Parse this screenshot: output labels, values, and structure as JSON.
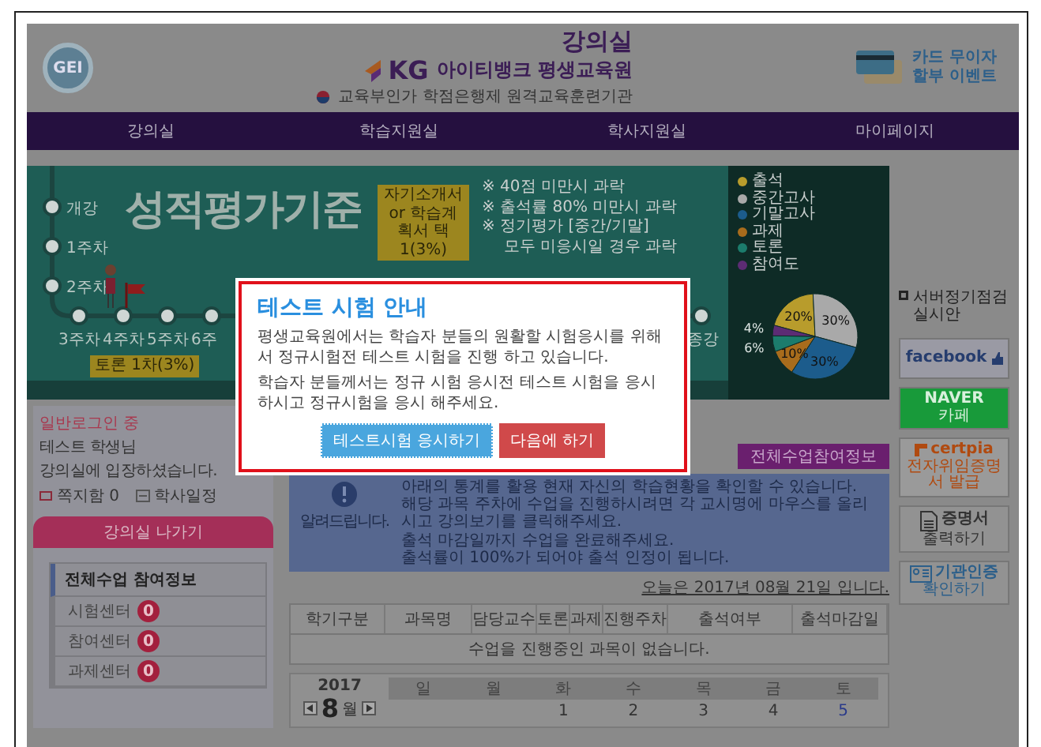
{
  "header": {
    "badge": "GEI",
    "room_title": "강의실",
    "kg": "KG",
    "academy": "아이티뱅크 평생교육원",
    "accreditation": "교육부인가 학점은행제 원격교육훈련기관",
    "event": [
      "카드 무이자",
      "할부 이벤트"
    ]
  },
  "nav": [
    {
      "label": "강의실",
      "selected": false
    },
    {
      "label": "학습지원실",
      "selected": false
    },
    {
      "label": "학사지원실",
      "selected": false
    },
    {
      "label": "마이페이지",
      "selected": false
    }
  ],
  "banner": {
    "title": "성적평가기준",
    "stops": [
      {
        "label": "개강",
        "kind": "vertical"
      },
      {
        "label": "1주차",
        "kind": "vertical"
      },
      {
        "label": "2주차",
        "kind": "vertical"
      },
      {
        "label": "3주차",
        "kind": "horizontal"
      },
      {
        "label": "4주차",
        "kind": "horizontal"
      },
      {
        "label": "5주차",
        "kind": "horizontal"
      },
      {
        "label": "6주",
        "kind": "horizontal"
      },
      {
        "label": "종강",
        "kind": "end"
      }
    ],
    "tags": [
      "토론 1차(3%)",
      "자기소개서 or 학습계획서 택1(3%)"
    ],
    "notes": [
      "※ 40점 미만시 과락",
      "※ 출석률 80% 미만시 과락",
      "※ 정기평가 [중간/기말]",
      "모두 미응시일 경우 과락"
    ],
    "chart_data": {
      "type": "pie",
      "categories": [
        "출석",
        "중간고사",
        "기말고사",
        "과제",
        "토론",
        "참여도"
      ],
      "values": [
        20,
        30,
        30,
        10,
        6,
        4
      ],
      "value_labels": [
        "20%",
        "30%",
        "30%",
        "10%",
        "6%",
        "4%"
      ],
      "colors": [
        "#b89c2c",
        "#a9a9a9",
        "#1c5c8c",
        "#a86c1c",
        "#1c7c6c",
        "#5c2c74"
      ]
    }
  },
  "login": {
    "status": "일반로그인 중",
    "user": "테스트 학생님",
    "welcome": "강의실에 입장하셨습니다.",
    "messages": "쪽지함 0",
    "schedule": "학사일정",
    "exit": "강의실 나가기"
  },
  "participation": {
    "title": "전체수업 참여정보",
    "centers": [
      {
        "label": "시험센터",
        "count": "0"
      },
      {
        "label": "참여센터",
        "count": "0"
      },
      {
        "label": "과제센터",
        "count": "0"
      }
    ]
  },
  "overview_button": "전체수업참여정보",
  "notice": {
    "label": "알려드립니다.",
    "lines": [
      "아래의 통계를 활용 현재 자신의 학습현황을 확인할 수 있습니다.",
      "해당 과목 주차에 수업을 진행하시려면 각 교시명에 마우스를 올리시고 강의보기를 클릭해주세요.",
      "출석 마감일까지 수업을 완료해주세요.",
      "출석률이 100%가 되어야 출석 인정이 됩니다."
    ]
  },
  "today": "오늘은 2017년 08월 21일 입니다.",
  "table": {
    "columns": [
      "학기구분",
      "과목명",
      "담당교수",
      "토론",
      "과제",
      "진행주차",
      "출석여부",
      "출석마감일"
    ],
    "empty": "수업을 진행중인 과목이 없습니다."
  },
  "calendar": {
    "year": "2017",
    "month": "8",
    "month_unit": "월",
    "weekdays": [
      "일",
      "월",
      "화",
      "수",
      "목",
      "금",
      "토"
    ],
    "first_week": [
      "1",
      "2",
      "3",
      "4",
      "5"
    ]
  },
  "side": {
    "notice": "서버정기점검실시안",
    "links": [
      {
        "kind": "facebook",
        "lines": [
          "facebook"
        ]
      },
      {
        "kind": "naver",
        "lines": [
          "NAVER",
          "카페"
        ]
      },
      {
        "kind": "certpia",
        "lines": [
          "certpia",
          "전자위임증명서 발급"
        ]
      },
      {
        "kind": "certificate",
        "lines": [
          "증명서",
          "출력하기"
        ]
      },
      {
        "kind": "verify",
        "lines": [
          "기관인증",
          "확인하기"
        ]
      }
    ]
  },
  "modal": {
    "title": "테스트 시험 안내",
    "paragraphs": [
      "평생교육원에서는 학습자 분들의 원활할 시험응시를 위해서 정규시험전 테스트 시험을 진행 하고 있습니다.",
      "학습자 분들께서는 정규 시험 응시전 테스트 시험을 응시하시고 정규시험을 응시 해주세요."
    ],
    "buttons": [
      {
        "label": "테스트시험 응시하기",
        "kind": "primary"
      },
      {
        "label": "다음에 하기",
        "kind": "secondary"
      }
    ]
  }
}
